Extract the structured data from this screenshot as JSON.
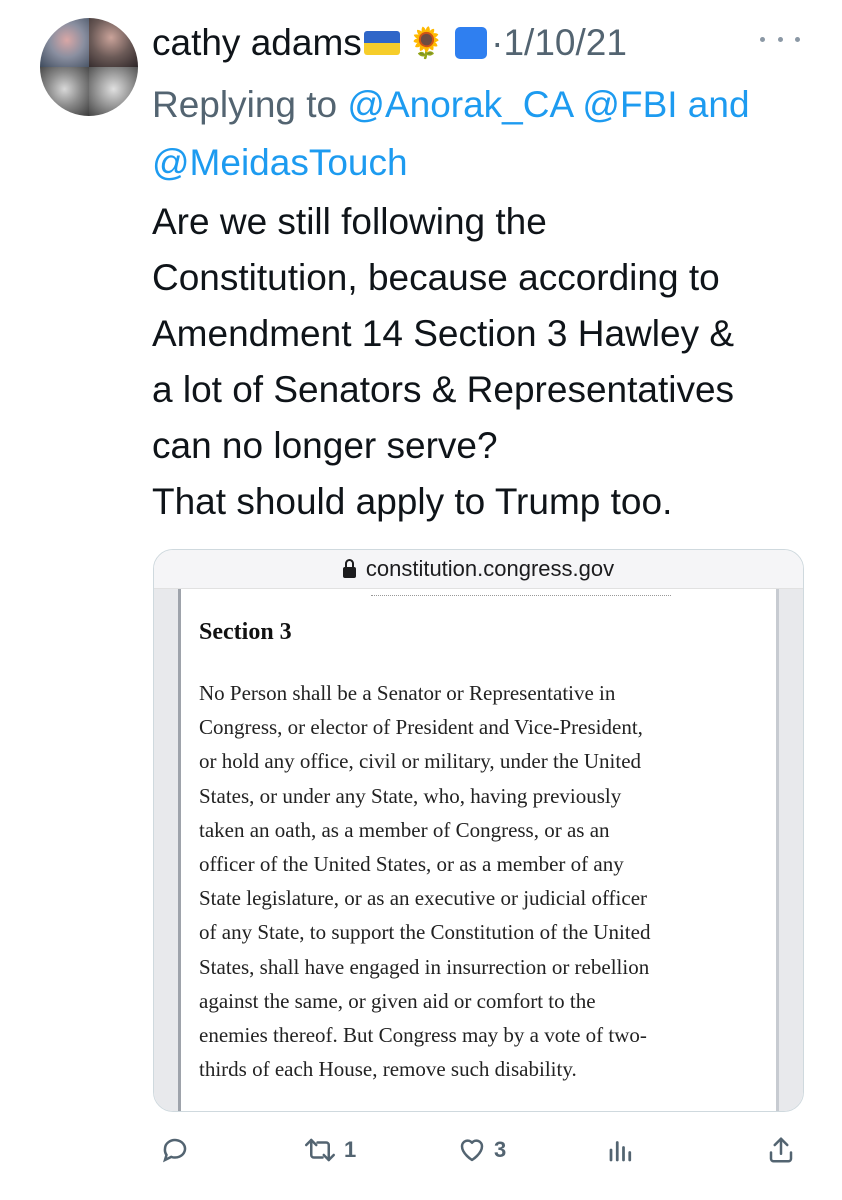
{
  "tweet": {
    "author": "cathy adams",
    "date": "1/10/21",
    "reply_prefix": "Replying to ",
    "mentions": [
      "@Anorak_CA",
      "@FBI",
      "@MeidasTouch"
    ],
    "mention_joiner": " and",
    "text_lines": [
      "Are we still following the",
      "Constitution, because according to",
      "Amendment 14 Section 3 Hawley &",
      "a lot of Senators & Representatives",
      "can no longer serve?",
      "That should apply to Trump too."
    ],
    "emoji": {
      "flag": "ukraine-flag-icon",
      "sunflower": "🌻",
      "square": "blue-square-icon"
    }
  },
  "card": {
    "url": "constitution.congress.gov",
    "heading": "Section 3",
    "body_lines": [
      "No Person shall be a Senator or Representative in",
      "Congress, or elector of President and Vice-President,",
      "or hold any office, civil or military, under the United",
      "States, or under any State, who, having previously",
      "taken an oath, as a member of Congress, or as an",
      "officer of the United States, or as a member of any",
      "State legislature, or as an executive or judicial officer",
      "of any State, to support the Constitution of the United",
      "States, shall have engaged in insurrection or rebellion",
      "against the same, or given aid or comfort to the",
      "enemies thereof. But Congress may by a vote of two-",
      "thirds of each House, remove such disability."
    ]
  },
  "actions": {
    "retweets": "1",
    "likes": "3"
  },
  "colors": {
    "link": "#1d9bf0",
    "secondary": "#536471",
    "text": "#0f1419"
  }
}
